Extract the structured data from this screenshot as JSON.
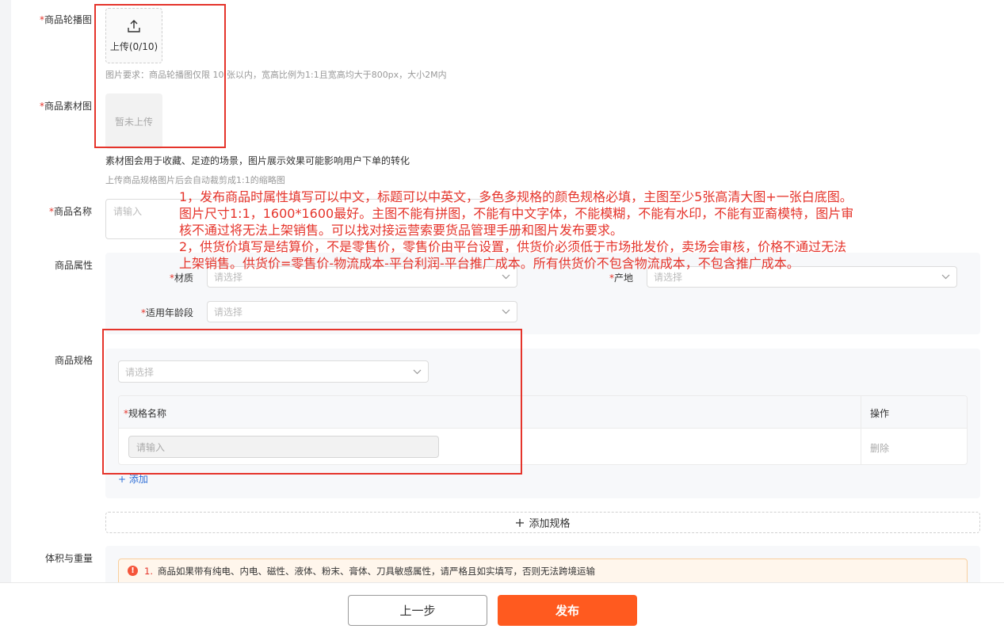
{
  "form": {
    "carousel": {
      "required_mark": "*",
      "label": "商品轮播图",
      "upload_text": "上传(0/10)",
      "hint": "图片要求：商品轮播图仅限 10 张以内，宽高比例为1:1且宽高均大于800px，大小2M内"
    },
    "material": {
      "required_mark": "*",
      "label": "商品素材图",
      "empty_text": "暂未上传",
      "note": "素材图会用于收藏、足迹的场景，图片展示效果可能影响用户下单的转化",
      "hint": "上传商品规格图片后会自动裁剪成1:1的缩略图"
    },
    "name": {
      "required_mark": "*",
      "label": "商品名称",
      "placeholder": "请输入"
    },
    "attributes": {
      "label": "商品属性",
      "fields": [
        {
          "required_mark": "*",
          "label": "材质",
          "placeholder": "请选择"
        },
        {
          "required_mark": "*",
          "label": "产地",
          "placeholder": "请选择"
        },
        {
          "required_mark": "*",
          "label": "适用年龄段",
          "placeholder": "请选择"
        }
      ]
    },
    "spec": {
      "label": "商品规格",
      "select_placeholder": "请选择",
      "table": {
        "col_name_required": "*",
        "col_name": "规格名称",
        "col_action": "操作",
        "row_placeholder": "请输入",
        "row_delete": "删除"
      },
      "add_link": "+ 添加",
      "add_spec_button": "添加规格"
    },
    "volume": {
      "label": "体积与重量",
      "warning_num": "1.",
      "warning_text": "商品如果带有纯电、内电、磁性、液体、粉末、膏体、刀具敏感属性，请严格且如实填写，否则无法跨境运输"
    }
  },
  "annotation": {
    "lines": [
      "1，发布商品时属性填写可以中文，标题可以中英文，多色多规格的颜色规格必填，主图至少5张高清大图+一张白底图。",
      "图片尺寸1:1，1600*1600最好。主图不能有拼图，不能有中文字体，不能模糊，不能有水印，不能有亚裔模特，图片审",
      "核不通过将无法上架销售。可以找对接运营索要货品管理手册和图片发布要求。",
      "2，供货价填写是结算价，不是零售价，零售价由平台设置，供货价必须低于市场批发价，卖场会审核，价格不通过无法",
      "上架销售。供货价=零售价-物流成本-平台利润-平台推广成本。所有供货价不包含物流成本，不包含推广成本。"
    ]
  },
  "footer": {
    "prev_label": "上一步",
    "publish_label": "发布"
  },
  "colors": {
    "accent": "#ff5a1f",
    "required": "#e5342b",
    "link": "#2f6fd6",
    "annotation": "#e5342b"
  },
  "icons": [
    "upload-icon",
    "chevron-down-icon",
    "plus-icon",
    "warning-icon"
  ]
}
